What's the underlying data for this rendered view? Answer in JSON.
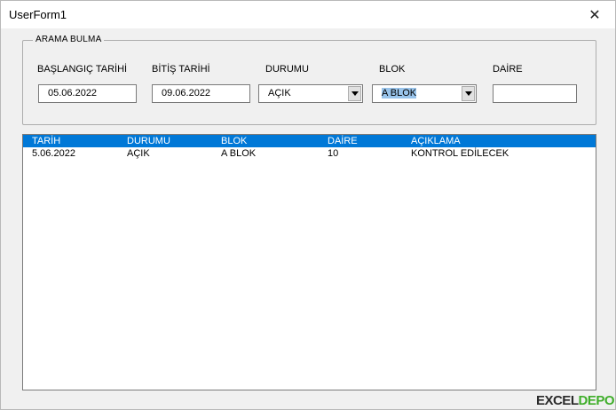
{
  "window": {
    "title": "UserForm1",
    "close_glyph": "✕"
  },
  "group": {
    "caption": "ARAMA BULMA",
    "fields": {
      "start_date": {
        "label": "BAŞLANGIÇ TARİHİ",
        "value": "05.06.2022"
      },
      "end_date": {
        "label": "BİTİŞ TARİHİ",
        "value": "09.06.2022"
      },
      "status": {
        "label": "DURUMU",
        "value": "AÇIK"
      },
      "block": {
        "label": "BLOK",
        "value": "A BLOK"
      },
      "apartment": {
        "label": "DAİRE",
        "value": ""
      }
    }
  },
  "list": {
    "columns": [
      "TARİH",
      "DURUMU",
      "BLOK",
      "DAİRE",
      "AÇIKLAMA"
    ],
    "rows": [
      [
        "5.06.2022",
        "AÇIK",
        "A BLOK",
        "10",
        "KONTROL EDİLECEK"
      ]
    ]
  },
  "watermark": {
    "part1": "EXCEL",
    "part2": "DEPO"
  },
  "colors": {
    "header_bg": "#0078d7",
    "selection": "#99c4eb",
    "watermark_accent": "#3fae2a"
  }
}
